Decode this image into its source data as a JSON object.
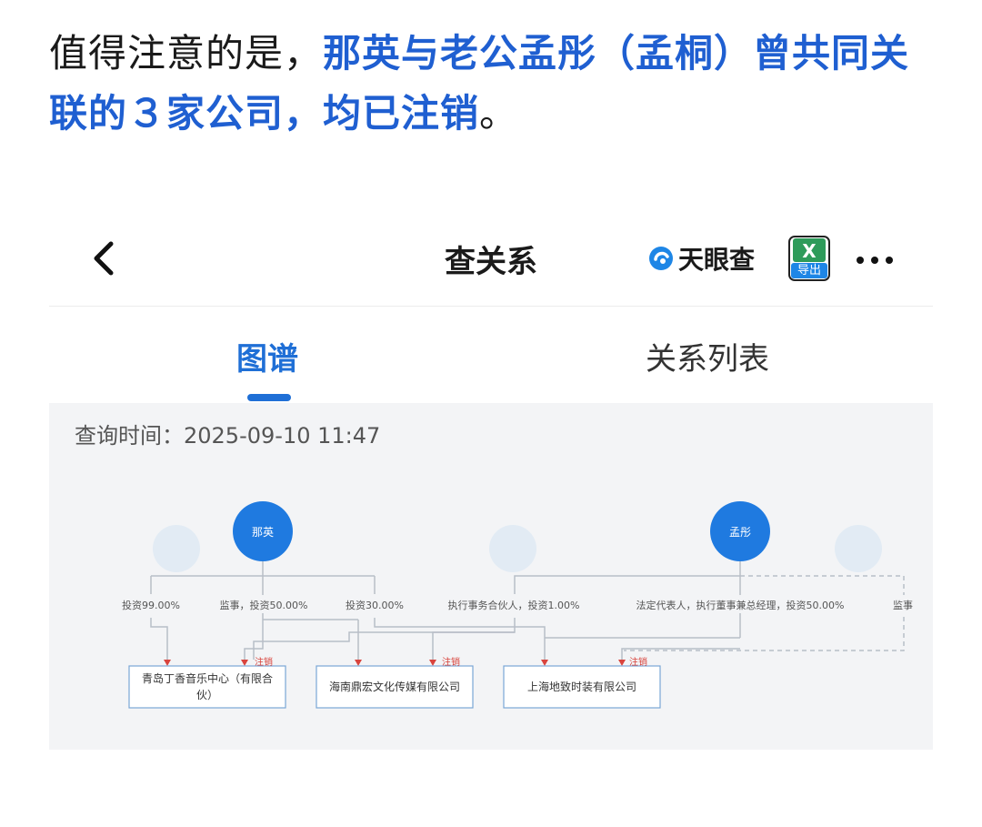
{
  "article": {
    "p1_plain": "值得注意的是，",
    "p1_highlight": "那英与老公孟彤（孟桐）曾共同关联的３家公司，均已注销",
    "p1_end": "。"
  },
  "header": {
    "back_label": "<",
    "title": "查关系",
    "brand": "天眼查",
    "export_label": "导出"
  },
  "tabs": [
    {
      "label": "图谱",
      "active": true
    },
    {
      "label": "关系列表",
      "active": false
    }
  ],
  "graph": {
    "query_time_label": "查询时间：",
    "query_time_value": "2025-09-10 11:47",
    "persons": [
      {
        "name": "那英"
      },
      {
        "name": "孟彤"
      }
    ],
    "relations": [
      "投资99.00%",
      "监事，投资50.00%",
      "投资30.00%",
      "执行事务合伙人，投资1.00%",
      "法定代表人，执行董事兼总经理，投资50.00%",
      "监事"
    ],
    "companies": [
      {
        "name_line1": "青岛丁香音乐中心（有限合",
        "name_line2": "伙）",
        "status": "注销"
      },
      {
        "name_line1": "海南鼎宏文化传媒有限公司",
        "name_line2": "",
        "status": "注销"
      },
      {
        "name_line1": "上海地致时装有限公司",
        "name_line2": "",
        "status": "注销"
      }
    ],
    "colors": {
      "person": "#1f7ae0",
      "edge": "#b8bec7",
      "arrow": "#d9443d",
      "status": "#d9443d",
      "company_border": "#7aa6d6"
    }
  }
}
